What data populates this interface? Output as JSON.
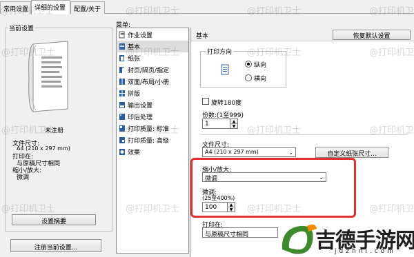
{
  "tabs": [
    "常用设置",
    "详细的设置",
    "配置/关于"
  ],
  "left_panel": {
    "title": "当前设置",
    "status": "未注册",
    "paper_size_label": "文件尺寸:",
    "paper_size_value": "A4 (210 x 297 mm)",
    "print_on_label": "打印在:",
    "print_on_value": "与原稿尺寸相同",
    "scale_label": "缩小/放大:",
    "scale_value": "微调",
    "preview_button": "设置摘要",
    "register_button": "注册当前设置..."
  },
  "menu": {
    "title": "菜单:",
    "items": [
      "作业设置",
      "基本",
      "纸张",
      "封页/隔页/指定",
      "双面/布局/小册",
      "拼版",
      "输出设置",
      "印后处理",
      "打印质量: 标准",
      "打印质量: 高级",
      "效果"
    ],
    "selected": "基本"
  },
  "content": {
    "header": "基本",
    "restore_button": "恢复默认设置",
    "orientation": {
      "title": "打印方向",
      "options": [
        "纵向",
        "横向"
      ],
      "selected": "纵向"
    },
    "rotate_label": "旋转180度",
    "copies_label": "份数:(1至999)",
    "copies_value": "1",
    "paper_size_label": "文件尺寸:",
    "paper_size_value": "A4 (210 x 297 mm)",
    "custom_size_button": "自定义纸张尺寸...",
    "scale_label": "缩小/放大:",
    "scale_value": "微调",
    "fine_label": "微调:",
    "fine_range": "(25至400%)",
    "fine_value": "100",
    "print_on_label": "打印在:",
    "print_on_value": "与原稿尺寸相同"
  },
  "watermark": "@打印机卫士",
  "brand": {
    "name": "吉德手游网",
    "url": "jdzhnl.com"
  },
  "colors": {
    "highlight": "#e0312f",
    "brand_green": "#3d8a2c",
    "brand_orange": "#f08a00"
  }
}
